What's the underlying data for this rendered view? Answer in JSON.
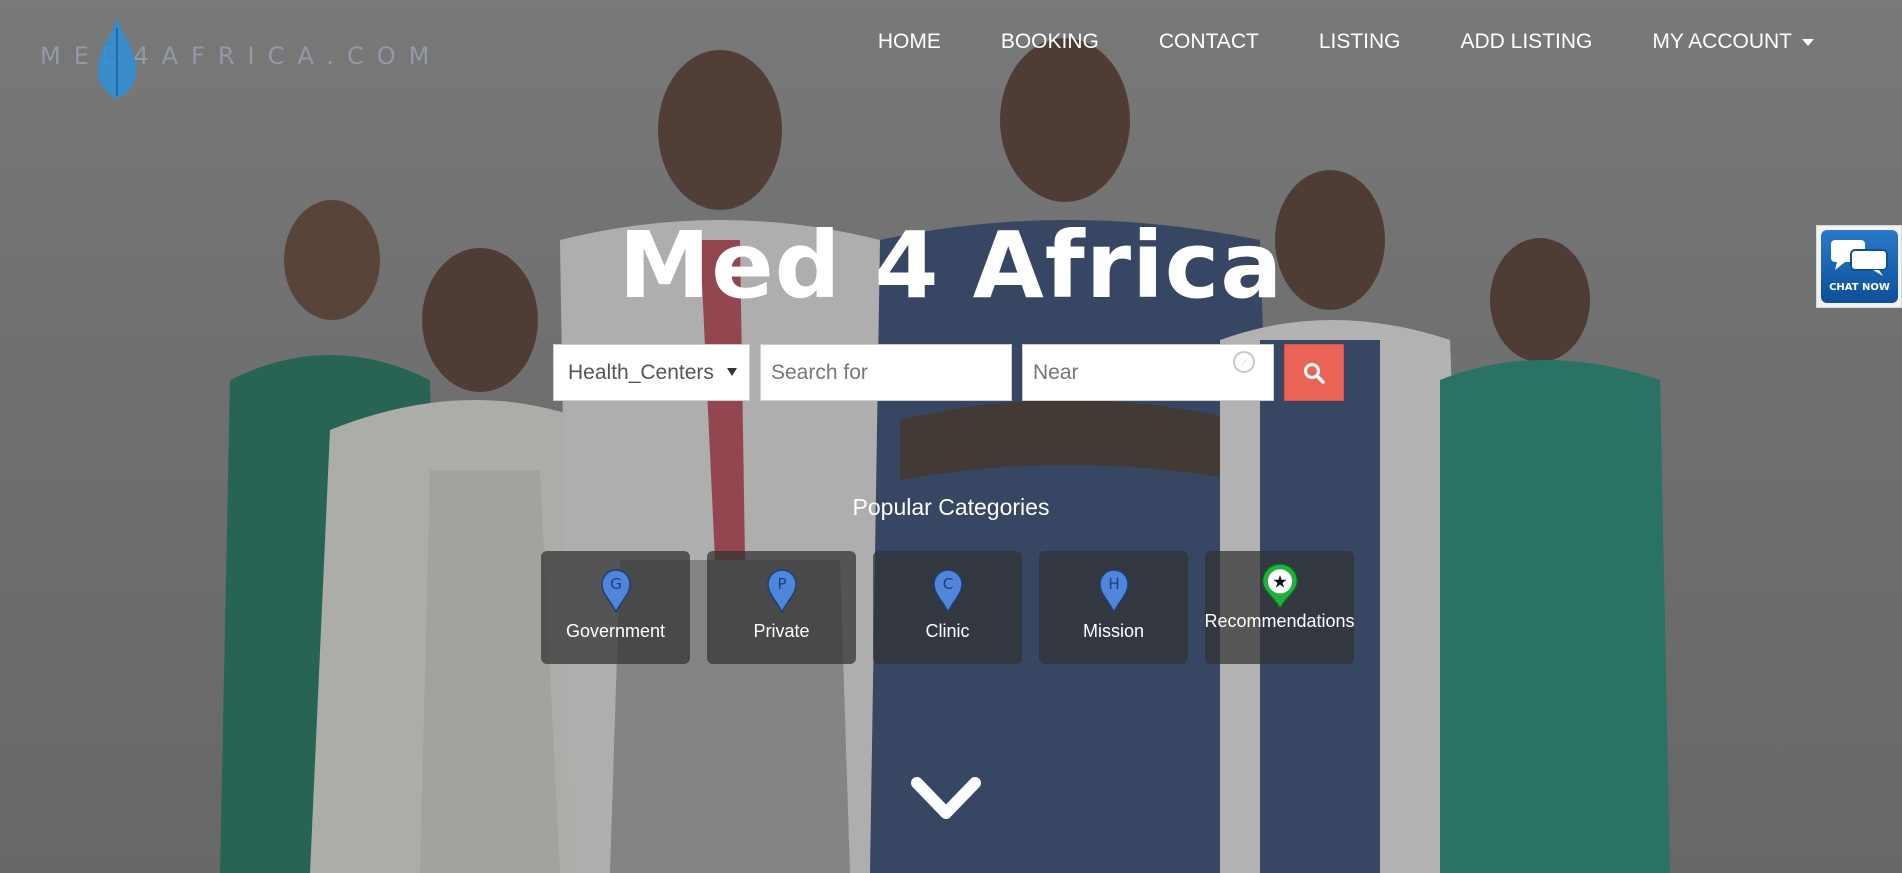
{
  "logo": {
    "text": "MED4AFRICA.COM"
  },
  "nav": {
    "items": [
      "HOME",
      "BOOKING",
      "CONTACT",
      "LISTING",
      "ADD LISTING",
      "MY ACCOUNT"
    ]
  },
  "chat": {
    "label": "CHAT NOW"
  },
  "hero": {
    "title": "Med 4 Africa"
  },
  "search": {
    "category_value": "Health_Centers",
    "search_placeholder": "Search for",
    "near_placeholder": "Near"
  },
  "categories": {
    "heading": "Popular Categories",
    "items": [
      {
        "label": "Government",
        "letter": "G",
        "color": "#4f86d9"
      },
      {
        "label": "Private",
        "letter": "P",
        "color": "#4f86d9"
      },
      {
        "label": "Clinic",
        "letter": "C",
        "color": "#4f86d9"
      },
      {
        "label": "Mission",
        "letter": "H",
        "color": "#4f86d9"
      },
      {
        "label": "Recommendations",
        "letter": "★",
        "color": "#1db33a"
      }
    ]
  },
  "colors": {
    "accent": "#e96356",
    "pin_blue": "#4f86d9",
    "pin_green": "#1db33a",
    "chat_blue": "#0d4f98"
  }
}
